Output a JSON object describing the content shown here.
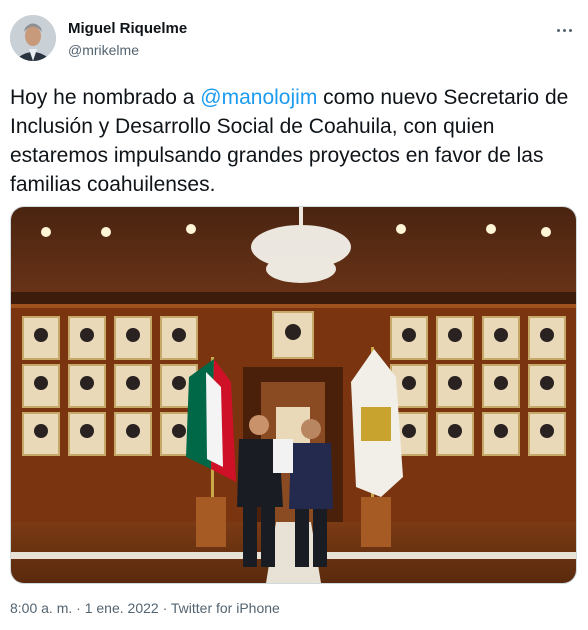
{
  "author": {
    "display_name": "Miguel Riquelme",
    "handle": "@mrikelme"
  },
  "tweet": {
    "text_before": "Hoy he nombrado a ",
    "mention": "@manolojim",
    "text_after": " como nuevo Secretario de Inclusión y Desarrollo Social de Coahuila, con quien estaremos impulsando grandes proyectos en favor de las familias coahuilenses."
  },
  "meta": {
    "time": "8:00 a. m.",
    "separator_1": " · ",
    "date": "1 ene. 2022",
    "separator_2": " · ",
    "source": "Twitter for iPhone"
  },
  "colors": {
    "link": "#1d9bf0",
    "secondary_text": "#536471",
    "primary_text": "#0f1419"
  }
}
